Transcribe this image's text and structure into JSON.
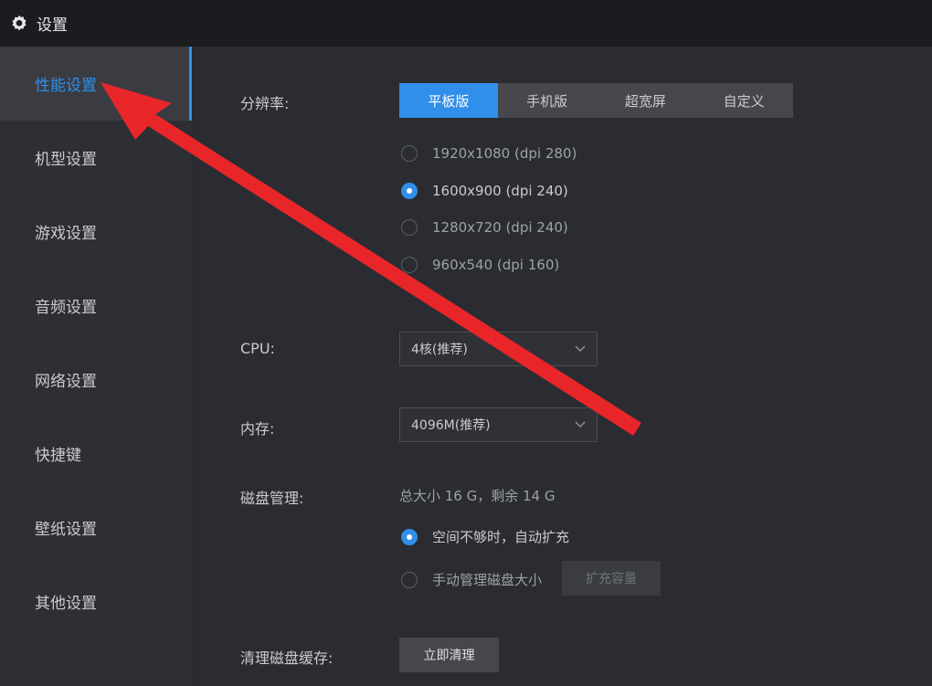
{
  "window": {
    "title": "设置"
  },
  "sidebar": {
    "items": [
      {
        "label": "性能设置",
        "active": true
      },
      {
        "label": "机型设置"
      },
      {
        "label": "游戏设置"
      },
      {
        "label": "音频设置"
      },
      {
        "label": "网络设置"
      },
      {
        "label": "快捷键"
      },
      {
        "label": "壁纸设置"
      },
      {
        "label": "其他设置"
      }
    ]
  },
  "resolution": {
    "label": "分辨率:",
    "tabs": [
      "平板版",
      "手机版",
      "超宽屏",
      "自定义"
    ],
    "active_tab": "平板版",
    "options": [
      "1920x1080  (dpi 280)",
      "1600x900  (dpi 240)",
      "1280x720  (dpi 240)",
      "960x540  (dpi 160)"
    ],
    "selected": "1600x900  (dpi 240)"
  },
  "cpu": {
    "label": "CPU:",
    "value": "4核(推荐)"
  },
  "memory": {
    "label": "内存:",
    "value": "4096M(推荐)"
  },
  "disk": {
    "label": "磁盘管理:",
    "info": "总大小 16 G，剩余 14 G",
    "options": [
      "空间不够时，自动扩充",
      "手动管理磁盘大小"
    ],
    "selected": "空间不够时，自动扩充",
    "expand_button": "扩充容量"
  },
  "cache": {
    "label": "清理磁盘缓存:",
    "button": "立即清理"
  },
  "colors": {
    "accent": "#2f8fea",
    "annotation_arrow": "#e8262a",
    "background": "#2a2c31"
  }
}
